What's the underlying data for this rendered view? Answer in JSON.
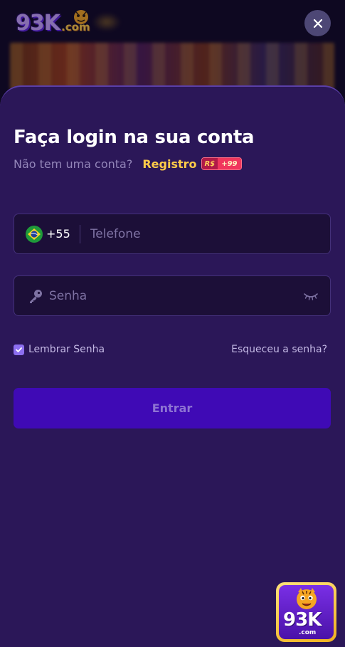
{
  "brand": {
    "logo_text": "93K",
    "logo_suffix": ".com"
  },
  "header": {
    "close_icon": "close-icon"
  },
  "login": {
    "title": "Faça login na sua conta",
    "no_account_text": "Não tem uma conta?",
    "register_label": "Registro",
    "bonus_currency": "R$",
    "bonus_value": "+99",
    "phone": {
      "country_icon": "brazil-flag-icon",
      "dial_code": "+55",
      "placeholder": "Telefone",
      "value": ""
    },
    "password": {
      "icon": "key-icon",
      "placeholder": "Senha",
      "value": "",
      "toggle_icon": "eye-closed-icon"
    },
    "remember": {
      "label": "Lembrar Senha",
      "checked": true
    },
    "forgot_label": "Esqueceu a senha?",
    "submit_label": "Entrar"
  },
  "app_icon": {
    "text": "93K",
    "suffix": ".com"
  },
  "colors": {
    "sheet_bg": "#2b1758",
    "accent_yellow": "#ffcb49",
    "submit_bg": "#3f0ab5",
    "checkbox": "#8d6ff0"
  }
}
